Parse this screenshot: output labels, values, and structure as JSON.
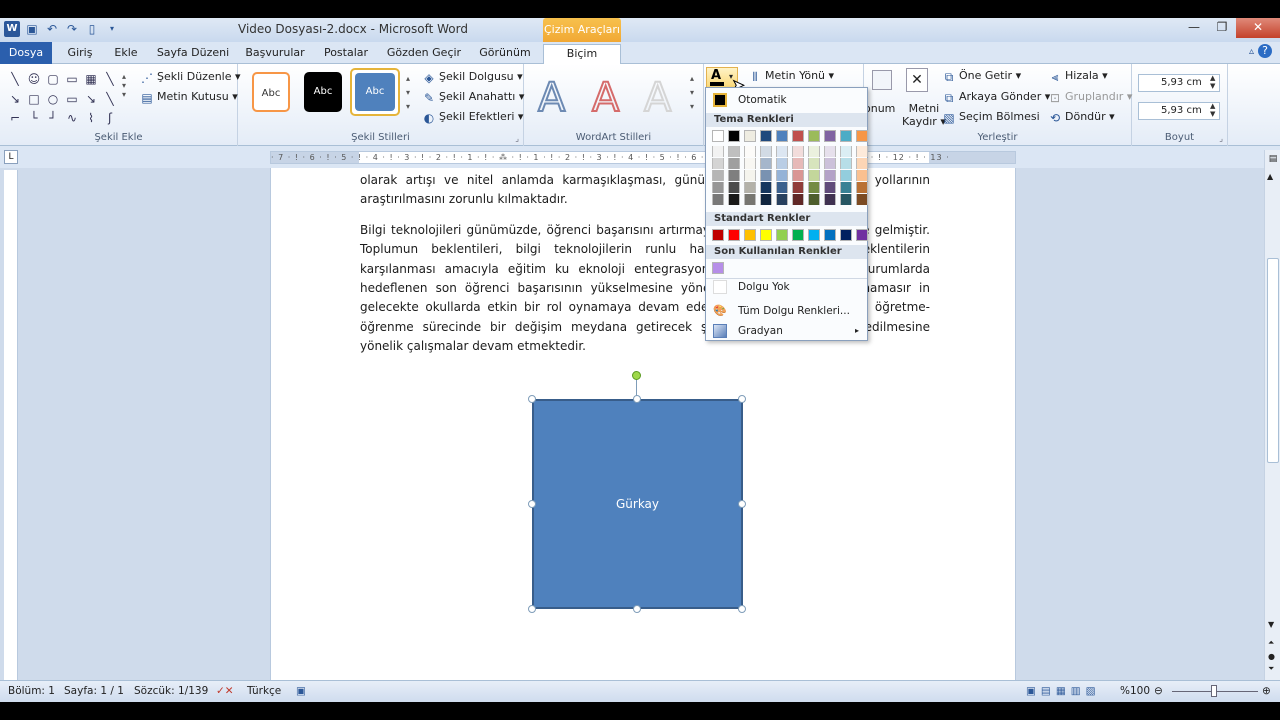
{
  "window": {
    "title": "Video Dosyası-2.docx - Microsoft Word",
    "context_tab_group": "Çizim Araçları"
  },
  "tabs": [
    {
      "label": "Dosya"
    },
    {
      "label": "Giriş"
    },
    {
      "label": "Ekle"
    },
    {
      "label": "Sayfa Düzeni"
    },
    {
      "label": "Başvurular"
    },
    {
      "label": "Postalar"
    },
    {
      "label": "Gözden Geçir"
    },
    {
      "label": "Görünüm"
    },
    {
      "label": "Biçim"
    }
  ],
  "ribbon": {
    "insert_shapes": {
      "edit_shape": "Şekli Düzenle",
      "text_box": "Metin Kutusu",
      "label": "Şekil Ekle"
    },
    "shape_styles": {
      "style_sample": "Abc",
      "fill": "Şekil Dolgusu",
      "outline": "Şekil Anahattı",
      "effects": "Şekil Efektleri",
      "label": "Şekil Stilleri"
    },
    "wordart": {
      "sample": "A",
      "label": "WordArt Stilleri"
    },
    "text": {
      "direction": "Metin Yönü"
    },
    "arrange": {
      "position_partial": "onum",
      "wrap_text_1": "Metni",
      "wrap_text_2": "Kaydır",
      "bring_forward": "Öne Getir",
      "send_backward": "Arkaya Gönder",
      "selection_pane": "Seçim Bölmesi",
      "align": "Hizala",
      "group": "Gruplandır",
      "rotate": "Döndür",
      "label": "Yerleştir"
    },
    "size": {
      "height": "5,93 cm",
      "width": "5,93 cm",
      "label": "Boyut"
    }
  },
  "ruler": {
    "marks": "· 7 · ! · 6 · ! · 5 · ! · 4 · ! · 3 · ! · 2 · ! · 1 · ! · ⁂ · ! · 1 · ! · 2 · ! · 3 · ! · 4 · ! · 5 · ! · 6 · ! · 7 · ! · 8 · ! · 9 · ! · 10 · ! · 11 · ! · 12 · ! · 13 ·"
  },
  "document": {
    "paragraph1": "olarak artışı ve nitel anlamda karmaşıklaşması, günümüz eğitim                                              hale getirme yollarının araştırılmasını zorunlu kılmaktadır.",
    "paragraph2": "Bilgi teknolojileri günümüzde, öğrenci başarısını artırmaya yar                                              lanlardan biri haline gelmiştir. Toplumun beklentileri, bilgi teknolojilerin                                            runlu hale getirmektedir. Bu beklentilerin karşılanması amacıyla eğitim ku                                           eknoloji entegrasyonu çalışmalarında, bazı durumlarda hedeflenen son                                          öğrenci başarısının yükselmesine yönelik beklentiler karşılanamamasır                                          in gelecekte okullarda etkin bir rol oynamaya devam edeceği öng                                            i teknolojilerinin öğretme-öğrenme sürecinde bir değişim meydana getirecek şekilde okullara entegre edilmesine yönelik çalışmalar devam etmektedir.",
    "shape_text": "Gürkay",
    "shape_fill": "#4f81bd"
  },
  "color_menu": {
    "automatic": "Otomatik",
    "theme_colors": "Tema Renkleri",
    "standard_colors": "Standart Renkler",
    "recent_colors": "Son Kullanılan Renkler",
    "no_fill": "Dolgu Yok",
    "more_colors": "Tüm Dolgu Renkleri...",
    "gradient": "Gradyan",
    "theme_top": [
      "#ffffff",
      "#000000",
      "#eeece1",
      "#1f497d",
      "#4f81bd",
      "#c0504d",
      "#9bbb59",
      "#8064a2",
      "#4bacc6",
      "#f79646"
    ],
    "standard": [
      "#c00000",
      "#ff0000",
      "#ffc000",
      "#ffff00",
      "#92d050",
      "#00b050",
      "#00b0f0",
      "#0070c0",
      "#002060",
      "#7030a0"
    ],
    "recent": [
      "#b68ee8"
    ]
  },
  "status": {
    "section": "Bölüm: 1",
    "page": "Sayfa: 1 / 1",
    "words": "Sözcük: 1/139",
    "language": "Türkçe",
    "zoom": "%100"
  }
}
